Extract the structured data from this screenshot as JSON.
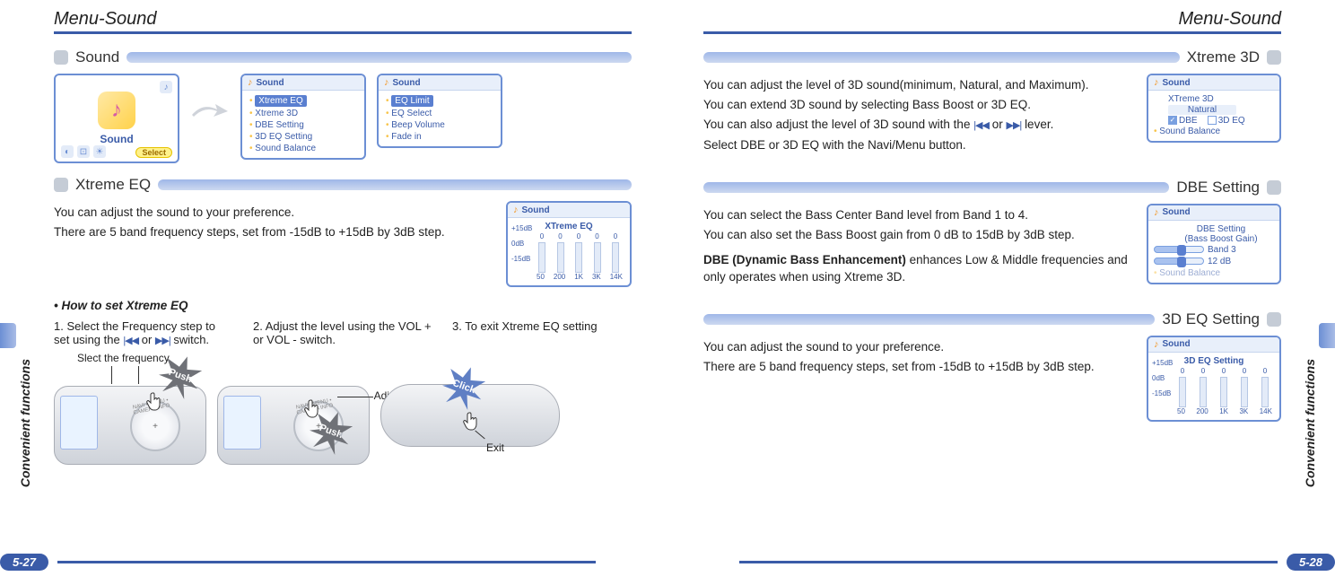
{
  "header_left": "Menu-Sound",
  "header_right": "Menu-Sound",
  "side_label": "Convenient functions",
  "footer_left": "5-27",
  "footer_right": "5-28",
  "left": {
    "section_sound": "Sound",
    "hero_label": "Sound",
    "hero_select": "Select",
    "menu1_title": "Sound",
    "menu1_items": [
      "Xtreme EQ",
      "Xtreme 3D",
      "DBE Setting",
      "3D EQ Setting",
      "Sound Balance"
    ],
    "menu2_title": "Sound",
    "menu2_items": [
      "EQ Limit",
      "EQ Select",
      "Beep Volume",
      "Fade in"
    ],
    "section_xeq": "Xtreme EQ",
    "xeq_text1": "You can adjust the sound to your preference.",
    "xeq_text2": "There are 5 band frequency steps, set from -15dB to +15dB by 3dB step.",
    "eq_shot_title": "Sound",
    "eq_label": "XTreme EQ",
    "eq_y": [
      "+15dB",
      "0dB",
      "-15dB"
    ],
    "eq_x": [
      "50",
      "200",
      "1K",
      "3K",
      "14K"
    ],
    "eq_zeros": "0",
    "howto_heading": "• How to set Xtreme EQ",
    "step1": "1. Select the Frequency step to set using the ",
    "step1b": " or ",
    "step1c": " switch.",
    "step2": "2. Adjust the level using the VOL + or VOL - switch.",
    "step3": "3. To exit Xtreme EQ setting",
    "cap_select_freq": "Slect the frequency",
    "cap_adjust": "Adjust level",
    "cap_exit": "Exit",
    "push_label": "Push",
    "click_label": "Click",
    "lever_left": "|◀◀",
    "lever_right": "▶▶|"
  },
  "right": {
    "section_x3d": "Xtreme 3D",
    "x3d_text1": "You can adjust the level of 3D sound(minimum, Natural, and Maximum).",
    "x3d_text2": "You can extend 3D sound by selecting Bass Boost or 3D EQ.",
    "x3d_text3a": "You can also adjust the level of 3D sound with the ",
    "x3d_text3b": " or ",
    "x3d_text3c": " lever.",
    "x3d_text4": "Select DBE or 3D EQ with the Navi/Menu button.",
    "x3d_shot_title": "Sound",
    "x3d_item": "XTreme 3D",
    "x3d_sub": "Natural",
    "x3d_opt1": "DBE",
    "x3d_opt2": "3D EQ",
    "x3d_below": "Sound Balance",
    "section_dbe": "DBE Setting",
    "dbe_text1": "You can select the Bass Center Band level from Band 1 to 4.",
    "dbe_text2": "You can also set the Bass Boost gain from 0 dB to 15dB by 3dB step.",
    "dbe_strong": "DBE (Dynamic Bass Enhancement)",
    "dbe_text3": " enhances Low & Middle frequencies and only operates when using Xtreme 3D.",
    "dbe_shot_title": "Sound",
    "dbe_item_line1": "DBE Setting",
    "dbe_item_line2": "(Bass Boost Gain)",
    "dbe_band": "Band 3",
    "dbe_gain": "12 dB",
    "dbe_below": "Sound Balance",
    "section_3deq": "3D EQ Setting",
    "eq3d_text1": "You can adjust the sound to your preference.",
    "eq3d_text2": "There are 5 band frequency steps, set from -15dB to +15dB by 3dB step.",
    "eq3d_shot_title": "Sound",
    "eq3d_label": "3D EQ Setting",
    "lever_left": "|◀◀",
    "lever_right": "▶▶|"
  },
  "chart_data": [
    {
      "type": "bar",
      "title": "XTreme EQ",
      "categories": [
        "50",
        "200",
        "1K",
        "3K",
        "14K"
      ],
      "values": [
        0,
        0,
        0,
        0,
        0
      ],
      "ylabel": "dB",
      "ylim": [
        -15,
        15
      ],
      "ytick": [
        "+15dB",
        "0dB",
        "-15dB"
      ]
    },
    {
      "type": "bar",
      "title": "3D EQ Setting",
      "categories": [
        "50",
        "200",
        "1K",
        "3K",
        "14K"
      ],
      "values": [
        0,
        0,
        0,
        0,
        0
      ],
      "ylabel": "dB",
      "ylim": [
        -15,
        15
      ],
      "ytick": [
        "+15dB",
        "0dB",
        "-15dB"
      ]
    }
  ]
}
